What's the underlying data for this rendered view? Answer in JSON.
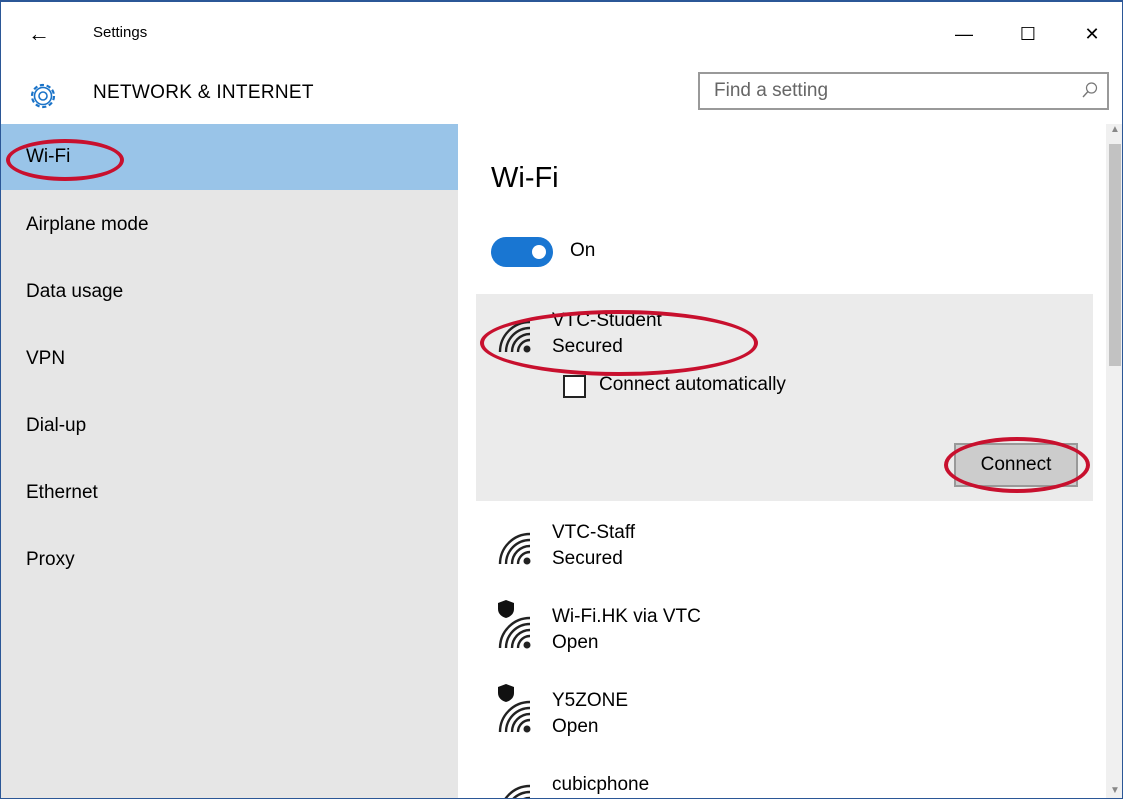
{
  "titlebar": {
    "back_icon": "←",
    "title": "Settings",
    "minimize_icon": "—",
    "maximize_icon": "☐",
    "close_icon": "✕"
  },
  "header": {
    "section_title": "NETWORK & INTERNET",
    "search_placeholder": "Find a setting"
  },
  "sidebar": {
    "items": [
      {
        "label": "Wi-Fi",
        "active": true
      },
      {
        "label": "Airplane mode"
      },
      {
        "label": "Data usage"
      },
      {
        "label": "VPN"
      },
      {
        "label": "Dial-up"
      },
      {
        "label": "Ethernet"
      },
      {
        "label": "Proxy"
      }
    ]
  },
  "main": {
    "heading": "Wi-Fi",
    "toggle_label": "On",
    "networks": [
      {
        "name": "VTC-Student",
        "status": "Secured",
        "connect_auto_label": "Connect automatically",
        "connect_label": "Connect"
      },
      {
        "name": "VTC-Staff",
        "status": "Secured"
      },
      {
        "name": "Wi-Fi.HK via VTC",
        "status": "Open"
      },
      {
        "name": "Y5ZONE",
        "status": "Open"
      },
      {
        "name": "cubicphone",
        "status": ""
      }
    ]
  },
  "colors": {
    "accent": "#1976d2",
    "sidebar_bg": "#e6e6e6",
    "sidebar_active": "#99c4e8",
    "annotation": "#c8102e"
  }
}
